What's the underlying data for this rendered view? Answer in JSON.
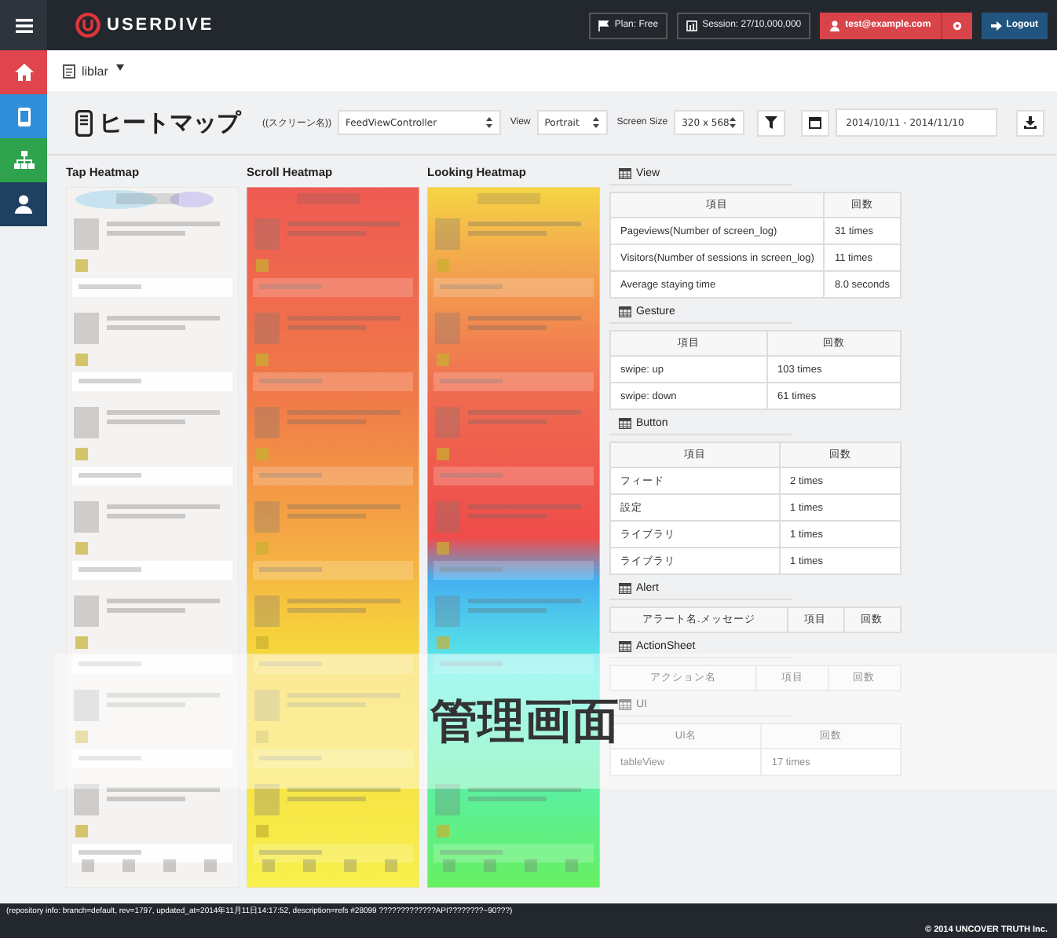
{
  "header": {
    "logo": "USERDIVE",
    "plan": "Plan: Free",
    "session": "Session: 27/10,000,000",
    "user": "test@example.com",
    "logout": "Logout"
  },
  "sidebar": {
    "items": [
      {
        "kind": "home",
        "color": "#e0444c"
      },
      {
        "kind": "device",
        "color": "#2f8fd8"
      },
      {
        "kind": "sitemap",
        "color": "#2fa24d"
      },
      {
        "kind": "user",
        "color": "#1f4060"
      }
    ]
  },
  "breadcrumb": {
    "app": "liblar"
  },
  "toolbar": {
    "title": "ヒートマップ",
    "screen_label": "((スクリーン名))",
    "screen": "FeedViewController",
    "view_label": "View",
    "view": "Portrait",
    "size_label": "Screen Size",
    "size": "320 x 568",
    "date_range": "2014/10/11 - 2014/11/10"
  },
  "heatmaps": [
    {
      "title": "Tap Heatmap",
      "kind": "tap"
    },
    {
      "title": "Scroll Heatmap",
      "kind": "scroll"
    },
    {
      "title": "Looking Heatmap",
      "kind": "looking"
    }
  ],
  "tables": [
    {
      "title": "View",
      "columns": [
        "項目",
        "回数"
      ],
      "rows": [
        [
          "Pageviews(Number of screen_log)",
          "31 times"
        ],
        [
          "Visitors(Number of sessions in screen_log)",
          "11 times"
        ],
        [
          "Average staying time",
          "8.0 seconds"
        ]
      ]
    },
    {
      "title": "Gesture",
      "columns": [
        "項目",
        "回数"
      ],
      "rows": [
        [
          "swipe: up",
          "103 times"
        ],
        [
          "swipe: down",
          "61 times"
        ]
      ]
    },
    {
      "title": "Button",
      "columns": [
        "項目",
        "回数"
      ],
      "rows": [
        [
          "フィード",
          "2 times"
        ],
        [
          "設定",
          "1 times"
        ],
        [
          "ライブラリ",
          "1 times"
        ],
        [
          "ライブラリ",
          "1 times"
        ]
      ]
    },
    {
      "title": "Alert",
      "columns": [
        "アラート名.メッセージ",
        "項目",
        "回数"
      ]
    },
    {
      "title": "ActionSheet",
      "columns": [
        "アクション名",
        "項目",
        "回数"
      ]
    },
    {
      "title": "UI",
      "columns": [
        "UI名",
        "回数"
      ],
      "rows": [
        [
          "tableView",
          "17 times"
        ]
      ]
    }
  ],
  "caption": "管理画面",
  "footer": {
    "repository_info": "(repository info: branch=default, rev=1797, updated_at=2014年11月11日14:17:52, description=refs #28099 ?????????????API????????~90???)",
    "copyright": "© 2014 UNCOVER TRUTH Inc."
  }
}
